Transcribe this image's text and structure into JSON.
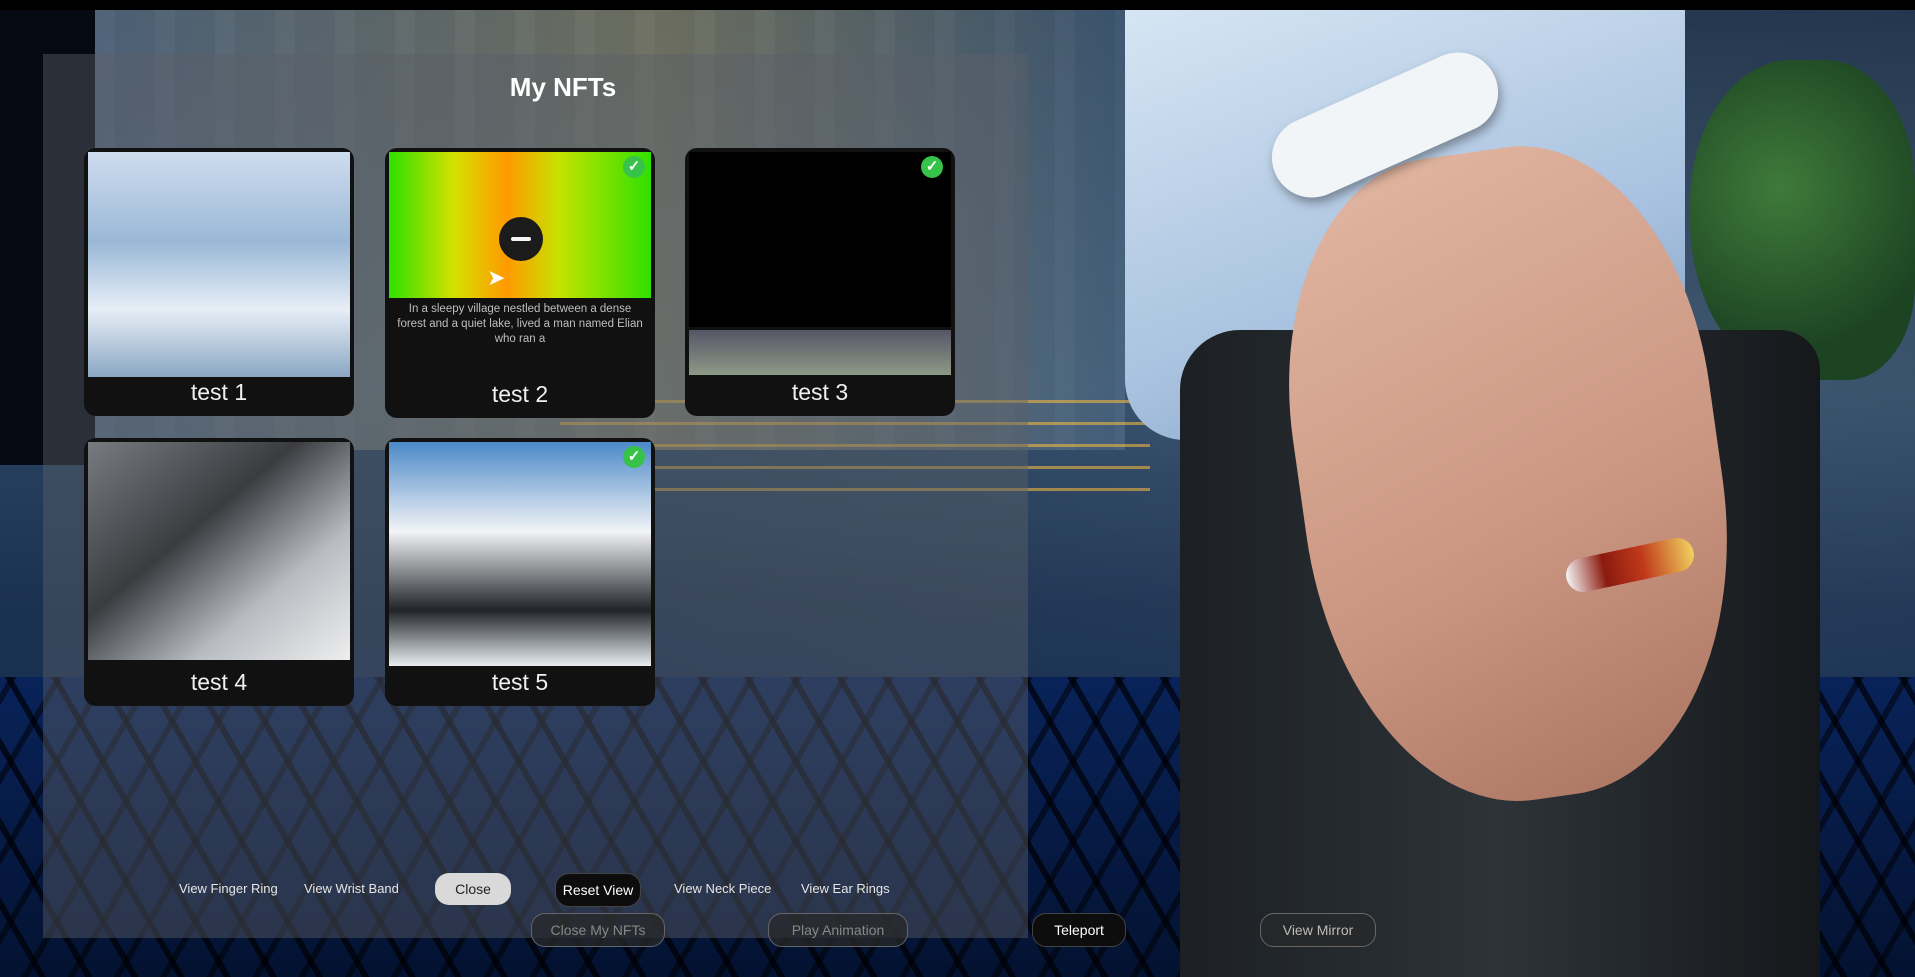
{
  "panel": {
    "title": "My NFTs"
  },
  "nfts": [
    {
      "label": "test 1",
      "selected": false,
      "description": ""
    },
    {
      "label": "test 2",
      "selected": true,
      "description": "In a sleepy village nestled between a dense forest and a quiet lake, lived a man named Elian who ran a"
    },
    {
      "label": "test 3",
      "selected": true,
      "description": ""
    },
    {
      "label": "test 4",
      "selected": false,
      "description": ""
    },
    {
      "label": "test 5",
      "selected": true,
      "description": ""
    }
  ],
  "icons": {
    "check": "check-circle-icon",
    "remove": "minus-circle-icon",
    "cursor": "mouse-pointer-icon"
  },
  "bottom_bar": {
    "view_finger_ring": "View Finger Ring",
    "view_wrist_band": "View Wrist Band",
    "close": "Close",
    "reset_view": "Reset View",
    "view_neck_piece": "View Neck Piece",
    "view_ear_rings": "View Ear Rings",
    "close_my_nfts": "Close My NFTs",
    "play_animation": "Play Animation",
    "teleport": "Teleport",
    "view_mirror": "View Mirror"
  },
  "colors": {
    "accent_check": "#37c24a",
    "panel_bg": "#5a5f69"
  }
}
